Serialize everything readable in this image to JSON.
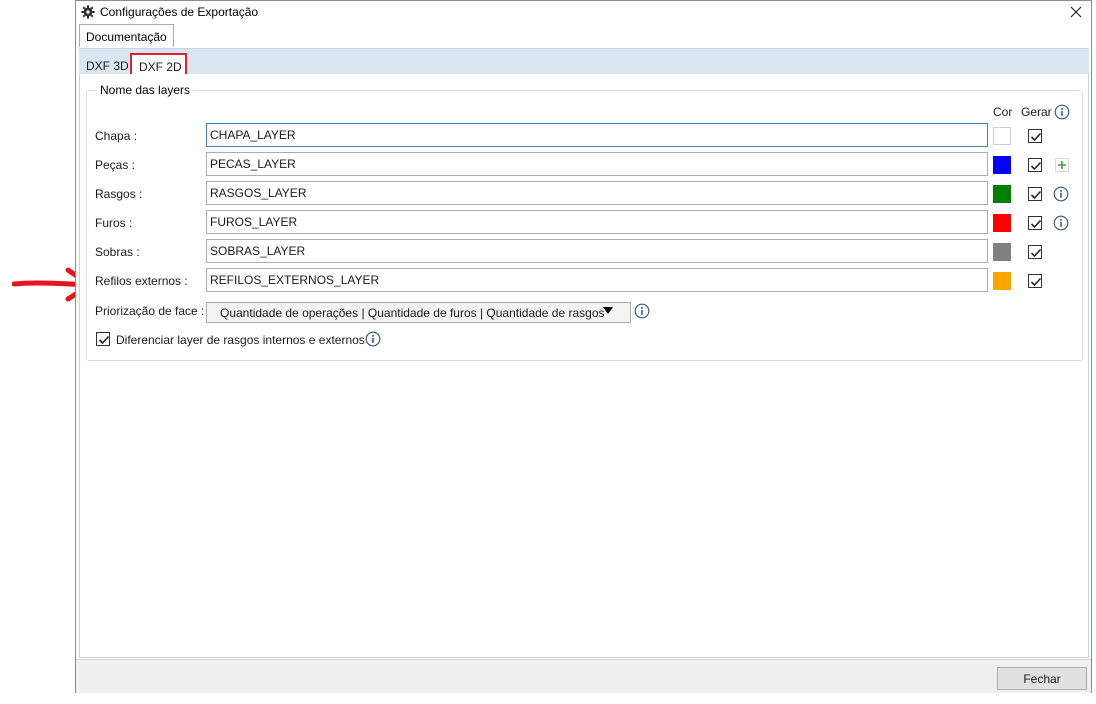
{
  "window": {
    "title": "Configurações de Exportação",
    "title_icon": "gear-icon",
    "close_icon": "close-icon"
  },
  "outer_tabs": [
    {
      "label": "Documentação"
    }
  ],
  "inner_tabs": [
    {
      "label": "DXF 3D"
    },
    {
      "label": "DXF 2D"
    }
  ],
  "group": {
    "title": "Nome das layers",
    "header_color": "Cor",
    "header_generate": "Gerar",
    "rows": [
      {
        "label": "Chapa :",
        "value": "CHAPA_LAYER",
        "color": "#ffffff",
        "checked": true
      },
      {
        "label": "Peças :",
        "value": "PECAS_LAYER",
        "color": "#0000ff",
        "checked": true,
        "extra_icon": "plus-icon"
      },
      {
        "label": "Rasgos :",
        "value": "RASGOS_LAYER",
        "color": "#008000",
        "checked": true,
        "extra_icon": "info-icon"
      },
      {
        "label": "Furos :",
        "value": "FUROS_LAYER",
        "color": "#ff0000",
        "checked": true,
        "extra_icon": "info-icon"
      },
      {
        "label": "Sobras :",
        "value": "SOBRAS_LAYER",
        "color": "#808080",
        "checked": true
      },
      {
        "label": "Refilos externos :",
        "value": "REFILOS_EXTERNOS_LAYER",
        "color": "#ffa500",
        "checked": true
      }
    ],
    "priority_label": "Priorização de face :",
    "priority_value": "Quantidade de operações | Quantidade de furos | Quantidade de rasgos",
    "differentiate_label": "Diferenciar layer de rasgos internos e externos",
    "differentiate_checked": true
  },
  "footer": {
    "close_label": "Fechar"
  },
  "annotation": {
    "arrow_color": "#e8141c",
    "highlight_color": "#e0202a"
  }
}
